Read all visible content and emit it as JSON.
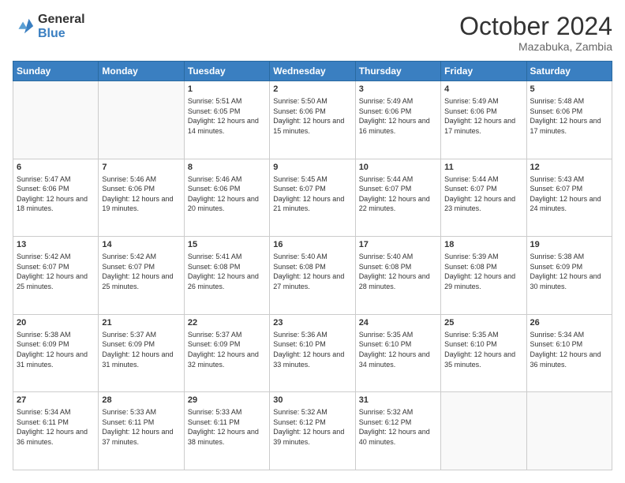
{
  "logo": {
    "general": "General",
    "blue": "Blue"
  },
  "header": {
    "month": "October 2024",
    "location": "Mazabuka, Zambia"
  },
  "weekdays": [
    "Sunday",
    "Monday",
    "Tuesday",
    "Wednesday",
    "Thursday",
    "Friday",
    "Saturday"
  ],
  "weeks": [
    [
      {
        "day": "",
        "sunrise": "",
        "sunset": "",
        "daylight": ""
      },
      {
        "day": "",
        "sunrise": "",
        "sunset": "",
        "daylight": ""
      },
      {
        "day": "1",
        "sunrise": "Sunrise: 5:51 AM",
        "sunset": "Sunset: 6:05 PM",
        "daylight": "Daylight: 12 hours and 14 minutes."
      },
      {
        "day": "2",
        "sunrise": "Sunrise: 5:50 AM",
        "sunset": "Sunset: 6:06 PM",
        "daylight": "Daylight: 12 hours and 15 minutes."
      },
      {
        "day": "3",
        "sunrise": "Sunrise: 5:49 AM",
        "sunset": "Sunset: 6:06 PM",
        "daylight": "Daylight: 12 hours and 16 minutes."
      },
      {
        "day": "4",
        "sunrise": "Sunrise: 5:49 AM",
        "sunset": "Sunset: 6:06 PM",
        "daylight": "Daylight: 12 hours and 17 minutes."
      },
      {
        "day": "5",
        "sunrise": "Sunrise: 5:48 AM",
        "sunset": "Sunset: 6:06 PM",
        "daylight": "Daylight: 12 hours and 17 minutes."
      }
    ],
    [
      {
        "day": "6",
        "sunrise": "Sunrise: 5:47 AM",
        "sunset": "Sunset: 6:06 PM",
        "daylight": "Daylight: 12 hours and 18 minutes."
      },
      {
        "day": "7",
        "sunrise": "Sunrise: 5:46 AM",
        "sunset": "Sunset: 6:06 PM",
        "daylight": "Daylight: 12 hours and 19 minutes."
      },
      {
        "day": "8",
        "sunrise": "Sunrise: 5:46 AM",
        "sunset": "Sunset: 6:06 PM",
        "daylight": "Daylight: 12 hours and 20 minutes."
      },
      {
        "day": "9",
        "sunrise": "Sunrise: 5:45 AM",
        "sunset": "Sunset: 6:07 PM",
        "daylight": "Daylight: 12 hours and 21 minutes."
      },
      {
        "day": "10",
        "sunrise": "Sunrise: 5:44 AM",
        "sunset": "Sunset: 6:07 PM",
        "daylight": "Daylight: 12 hours and 22 minutes."
      },
      {
        "day": "11",
        "sunrise": "Sunrise: 5:44 AM",
        "sunset": "Sunset: 6:07 PM",
        "daylight": "Daylight: 12 hours and 23 minutes."
      },
      {
        "day": "12",
        "sunrise": "Sunrise: 5:43 AM",
        "sunset": "Sunset: 6:07 PM",
        "daylight": "Daylight: 12 hours and 24 minutes."
      }
    ],
    [
      {
        "day": "13",
        "sunrise": "Sunrise: 5:42 AM",
        "sunset": "Sunset: 6:07 PM",
        "daylight": "Daylight: 12 hours and 25 minutes."
      },
      {
        "day": "14",
        "sunrise": "Sunrise: 5:42 AM",
        "sunset": "Sunset: 6:07 PM",
        "daylight": "Daylight: 12 hours and 25 minutes."
      },
      {
        "day": "15",
        "sunrise": "Sunrise: 5:41 AM",
        "sunset": "Sunset: 6:08 PM",
        "daylight": "Daylight: 12 hours and 26 minutes."
      },
      {
        "day": "16",
        "sunrise": "Sunrise: 5:40 AM",
        "sunset": "Sunset: 6:08 PM",
        "daylight": "Daylight: 12 hours and 27 minutes."
      },
      {
        "day": "17",
        "sunrise": "Sunrise: 5:40 AM",
        "sunset": "Sunset: 6:08 PM",
        "daylight": "Daylight: 12 hours and 28 minutes."
      },
      {
        "day": "18",
        "sunrise": "Sunrise: 5:39 AM",
        "sunset": "Sunset: 6:08 PM",
        "daylight": "Daylight: 12 hours and 29 minutes."
      },
      {
        "day": "19",
        "sunrise": "Sunrise: 5:38 AM",
        "sunset": "Sunset: 6:09 PM",
        "daylight": "Daylight: 12 hours and 30 minutes."
      }
    ],
    [
      {
        "day": "20",
        "sunrise": "Sunrise: 5:38 AM",
        "sunset": "Sunset: 6:09 PM",
        "daylight": "Daylight: 12 hours and 31 minutes."
      },
      {
        "day": "21",
        "sunrise": "Sunrise: 5:37 AM",
        "sunset": "Sunset: 6:09 PM",
        "daylight": "Daylight: 12 hours and 31 minutes."
      },
      {
        "day": "22",
        "sunrise": "Sunrise: 5:37 AM",
        "sunset": "Sunset: 6:09 PM",
        "daylight": "Daylight: 12 hours and 32 minutes."
      },
      {
        "day": "23",
        "sunrise": "Sunrise: 5:36 AM",
        "sunset": "Sunset: 6:10 PM",
        "daylight": "Daylight: 12 hours and 33 minutes."
      },
      {
        "day": "24",
        "sunrise": "Sunrise: 5:35 AM",
        "sunset": "Sunset: 6:10 PM",
        "daylight": "Daylight: 12 hours and 34 minutes."
      },
      {
        "day": "25",
        "sunrise": "Sunrise: 5:35 AM",
        "sunset": "Sunset: 6:10 PM",
        "daylight": "Daylight: 12 hours and 35 minutes."
      },
      {
        "day": "26",
        "sunrise": "Sunrise: 5:34 AM",
        "sunset": "Sunset: 6:10 PM",
        "daylight": "Daylight: 12 hours and 36 minutes."
      }
    ],
    [
      {
        "day": "27",
        "sunrise": "Sunrise: 5:34 AM",
        "sunset": "Sunset: 6:11 PM",
        "daylight": "Daylight: 12 hours and 36 minutes."
      },
      {
        "day": "28",
        "sunrise": "Sunrise: 5:33 AM",
        "sunset": "Sunset: 6:11 PM",
        "daylight": "Daylight: 12 hours and 37 minutes."
      },
      {
        "day": "29",
        "sunrise": "Sunrise: 5:33 AM",
        "sunset": "Sunset: 6:11 PM",
        "daylight": "Daylight: 12 hours and 38 minutes."
      },
      {
        "day": "30",
        "sunrise": "Sunrise: 5:32 AM",
        "sunset": "Sunset: 6:12 PM",
        "daylight": "Daylight: 12 hours and 39 minutes."
      },
      {
        "day": "31",
        "sunrise": "Sunrise: 5:32 AM",
        "sunset": "Sunset: 6:12 PM",
        "daylight": "Daylight: 12 hours and 40 minutes."
      },
      {
        "day": "",
        "sunrise": "",
        "sunset": "",
        "daylight": ""
      },
      {
        "day": "",
        "sunrise": "",
        "sunset": "",
        "daylight": ""
      }
    ]
  ]
}
